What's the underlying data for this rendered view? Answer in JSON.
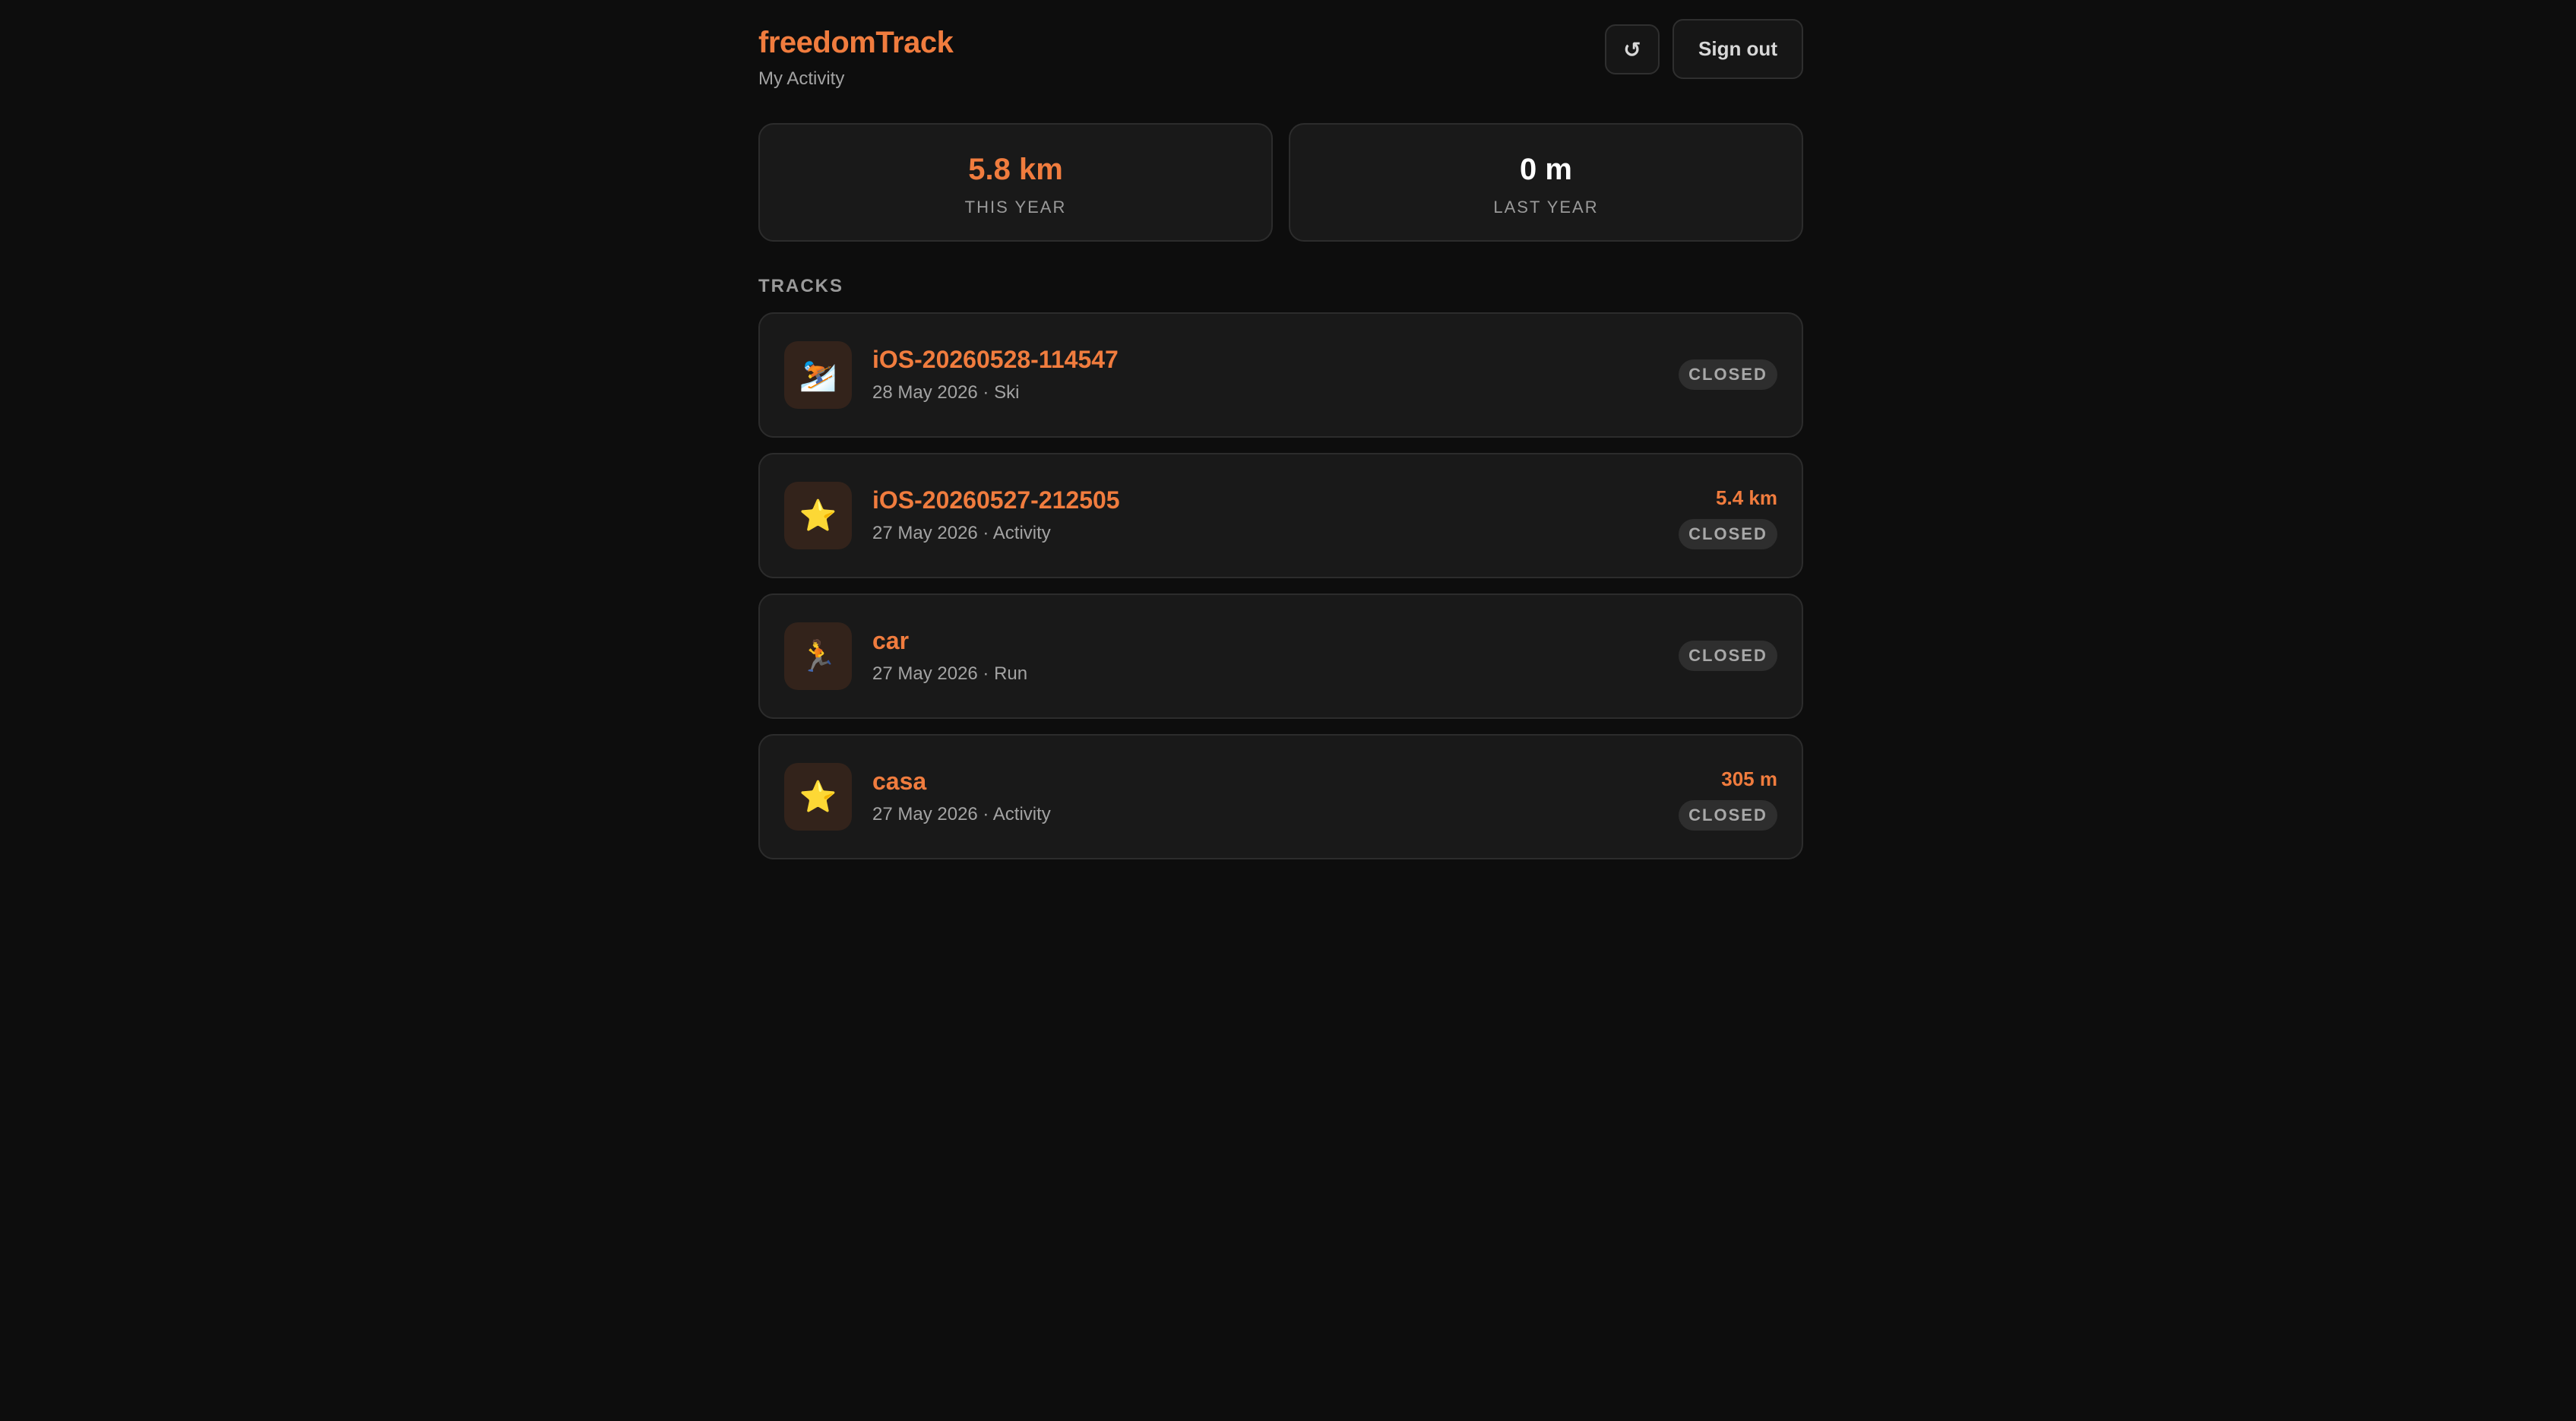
{
  "header": {
    "app_title": "freedomTrack",
    "subtitle": "My Activity",
    "refresh_icon": "↺",
    "refresh_icon_name": "refresh-icon",
    "signout_label": "Sign out"
  },
  "stats": {
    "this_year": {
      "value": "5.8 km",
      "label": "THIS YEAR"
    },
    "last_year": {
      "value": "0 m",
      "label": "LAST YEAR"
    }
  },
  "tracks_section": {
    "label": "TRACKS",
    "items": [
      {
        "icon_name": "skier-icon",
        "icon": "⛷️",
        "name": "iOS-20260528-114547",
        "meta": "28 May 2026 · Ski",
        "distance": "",
        "status": "CLOSED"
      },
      {
        "icon_name": "star-icon",
        "icon": "⭐",
        "name": "iOS-20260527-212505",
        "meta": "27 May 2026 · Activity",
        "distance": "5.4 km",
        "status": "CLOSED"
      },
      {
        "icon_name": "runner-icon",
        "icon": "🏃",
        "name": "car",
        "meta": "27 May 2026 · Run",
        "distance": "",
        "status": "CLOSED"
      },
      {
        "icon_name": "star-icon",
        "icon": "⭐",
        "name": "casa",
        "meta": "27 May 2026 · Activity",
        "distance": "305 m",
        "status": "CLOSED"
      }
    ]
  },
  "colors": {
    "background": "#0d0d0d",
    "card": "#191919",
    "accent": "#f07c3e",
    "muted_text": "#a3a3a3",
    "badge_bg": "#2e2e2e"
  }
}
